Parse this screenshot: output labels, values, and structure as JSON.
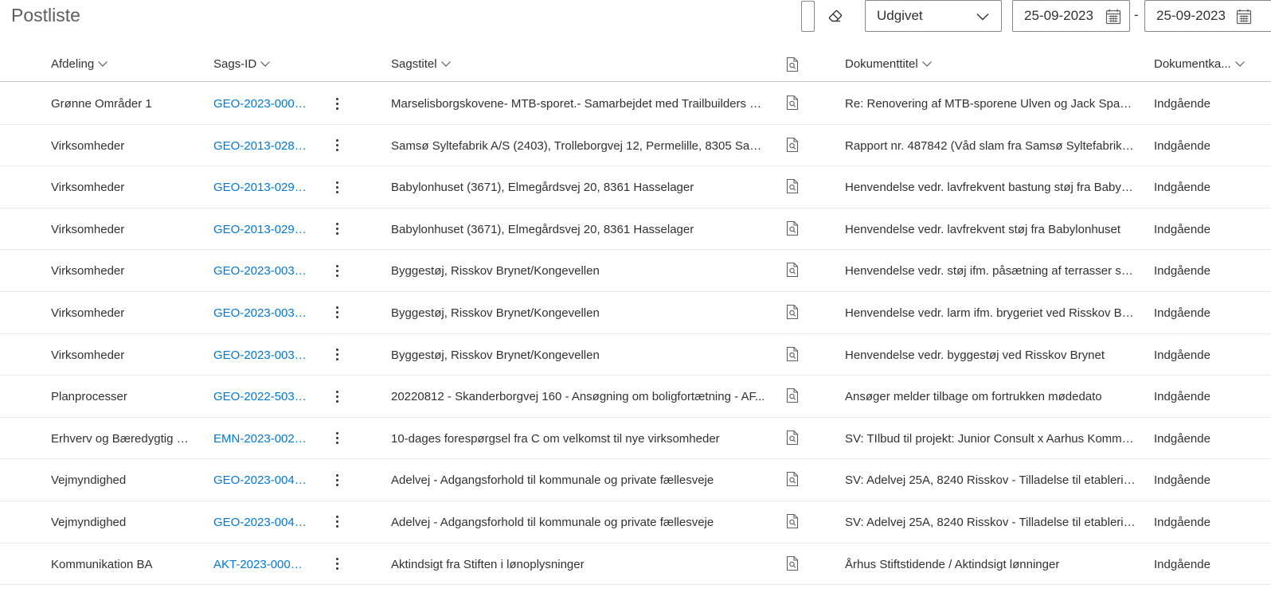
{
  "page": {
    "title": "Postliste"
  },
  "filters": {
    "status_select": "Udgivet",
    "date_from": "25-09-2023",
    "date_separator": "-",
    "date_to": "25-09-2023"
  },
  "colors": {
    "link": "#0078d4",
    "text": "#323130",
    "border": "#8a8886"
  },
  "columns": {
    "afdeling": "Afdeling",
    "sags_id": "Sags-ID",
    "sagstitel": "Sagstitel",
    "document_icon": "document-search-icon",
    "dokumenttitel": "Dokumenttitel",
    "dokumentkategori": "Dokumentka..."
  },
  "rows": [
    {
      "afdeling": "Grønne Områder 1",
      "sags_id": "GEO-2023-0002...",
      "sagstitel": "Marselisborgskovene- MTB-sporet.- Samarbejdet med Trailbuilders 20...",
      "dokumenttitel": "Re: Renovering af MTB-sporene Ulven og Jack Sparro...",
      "dokumentkategori": "Indgående"
    },
    {
      "afdeling": "Virksomheder",
      "sags_id": "GEO-2013-0285...",
      "sagstitel": "Samsø Syltefabrik A/S (2403), Trolleborgvej 12, Permelille, 8305 Samsø",
      "dokumenttitel": "Rapport nr. 487842 (Våd slam fra Samsø Syltefabrik A/...",
      "dokumentkategori": "Indgående"
    },
    {
      "afdeling": "Virksomheder",
      "sags_id": "GEO-2013-0296...",
      "sagstitel": "Babylonhuset (3671), Elmegårdsvej 20, 8361 Hasselager",
      "dokumenttitel": "Henvendelse vedr. lavfrekvent bastung støj fra Babylo...",
      "dokumentkategori": "Indgående"
    },
    {
      "afdeling": "Virksomheder",
      "sags_id": "GEO-2013-0296...",
      "sagstitel": "Babylonhuset (3671), Elmegårdsvej 20, 8361 Hasselager",
      "dokumenttitel": "Henvendelse vedr. lavfrekvent støj fra Babylonhuset",
      "dokumentkategori": "Indgående"
    },
    {
      "afdeling": "Virksomheder",
      "sags_id": "GEO-2023-0031...",
      "sagstitel": "Byggestøj, Risskov Brynet/Kongevellen",
      "dokumenttitel": "Henvendelse vedr. støj ifm. påsætning af terrasser søn...",
      "dokumentkategori": "Indgående"
    },
    {
      "afdeling": "Virksomheder",
      "sags_id": "GEO-2023-0031...",
      "sagstitel": "Byggestøj, Risskov Brynet/Kongevellen",
      "dokumenttitel": "Henvendelse vedr. larm ifm. brygeriet ved Risskov Bry...",
      "dokumentkategori": "Indgående"
    },
    {
      "afdeling": "Virksomheder",
      "sags_id": "GEO-2023-0031...",
      "sagstitel": "Byggestøj, Risskov Brynet/Kongevellen",
      "dokumenttitel": "Henvendelse vedr. byggestøj ved Risskov Brynet",
      "dokumentkategori": "Indgående"
    },
    {
      "afdeling": "Planprocesser",
      "sags_id": "GEO-2022-5038...",
      "sagstitel": "20220812 - Skanderborgvej 160 - Ansøgning om boligfortætning - AF...",
      "dokumenttitel": "Ansøger melder tilbage om fortrukken mødedato",
      "dokumentkategori": "Indgående"
    },
    {
      "afdeling": "Erhverv og Bæredygtig U...",
      "sags_id": "EMN-2023-0021...",
      "sagstitel": "10-dages forespørgsel fra C om velkomst til nye virksomheder",
      "dokumenttitel": "SV: TIlbud til projekt: Junior Consult x Aarhus Kommune",
      "dokumentkategori": "Indgående"
    },
    {
      "afdeling": "Vejmyndighed",
      "sags_id": "GEO-2023-0047...",
      "sagstitel": "Adelvej - Adgangsforhold til kommunale og private fællesveje",
      "dokumenttitel": "SV: Adelvej 25A, 8240 Risskov - Tilladelse til etablering...",
      "dokumentkategori": "Indgående"
    },
    {
      "afdeling": "Vejmyndighed",
      "sags_id": "GEO-2023-0047...",
      "sagstitel": "Adelvej - Adgangsforhold til kommunale og private fællesveje",
      "dokumenttitel": "SV: Adelvej 25A, 8240 Risskov - Tilladelse til etablering...",
      "dokumentkategori": "Indgående"
    },
    {
      "afdeling": "Kommunikation BA",
      "sags_id": "AKT-2023-000784",
      "sagstitel": "Aktindsigt fra Stiften i lønoplysninger",
      "dokumenttitel": "Århus Stiftstidende / Aktindsigt lønninger",
      "dokumentkategori": "Indgående"
    }
  ]
}
